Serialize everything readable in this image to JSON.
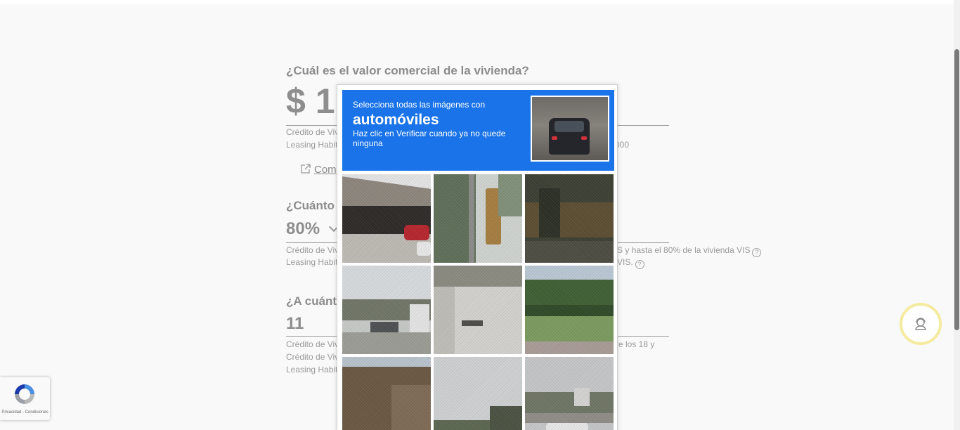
{
  "form": {
    "q1": "¿Cuál es el valor comercial de la vivienda?",
    "q1_value": "$ 1",
    "q1_note1": "Crédito de Vivi",
    "q1_note2": "Leasing Habit",
    "q1_note2_right": "000",
    "compare_link": "Com",
    "q2": "¿Cuánto d",
    "q2_value": "80%",
    "q2_note1": "Crédito de Viv",
    "q2_note1_right": "S y hasta el 80% de la vivienda VIS",
    "q2_note2": "Leasing Habit",
    "q2_note2_right": "VIS.",
    "q3": "¿A cuánto",
    "q3_value": "11",
    "q3_note1": "Crédito de Viv",
    "q3_note1_right": "re los 18 y",
    "q3_note2": "Crédito de Viv",
    "q3_note3": "Leasing Habit",
    "help_symbol": "?"
  },
  "captcha": {
    "line1": "Selecciona todas las imágenes con",
    "target": "automóviles",
    "line3": "Haz clic en Verificar cuando ya no quede ninguna",
    "tiles": [
      {
        "scene": "overpass-with-cars"
      },
      {
        "scene": "traffic-light-trees"
      },
      {
        "scene": "dark-trees"
      },
      {
        "scene": "road-traffic-lights"
      },
      {
        "scene": "empty-street"
      },
      {
        "scene": "grass-median"
      },
      {
        "scene": "brick-building"
      },
      {
        "scene": "sky-trees"
      },
      {
        "scene": "intersection-truck"
      }
    ]
  },
  "badge": {
    "links": "Privacidad - Condiciones"
  },
  "colors": {
    "captcha_blue": "#1a73e8",
    "fab_ring": "#f5eba0"
  },
  "icons": {
    "external_link": "external-link-icon",
    "recaptcha": "recaptcha-logo-icon",
    "chat": "support-agent-icon"
  }
}
